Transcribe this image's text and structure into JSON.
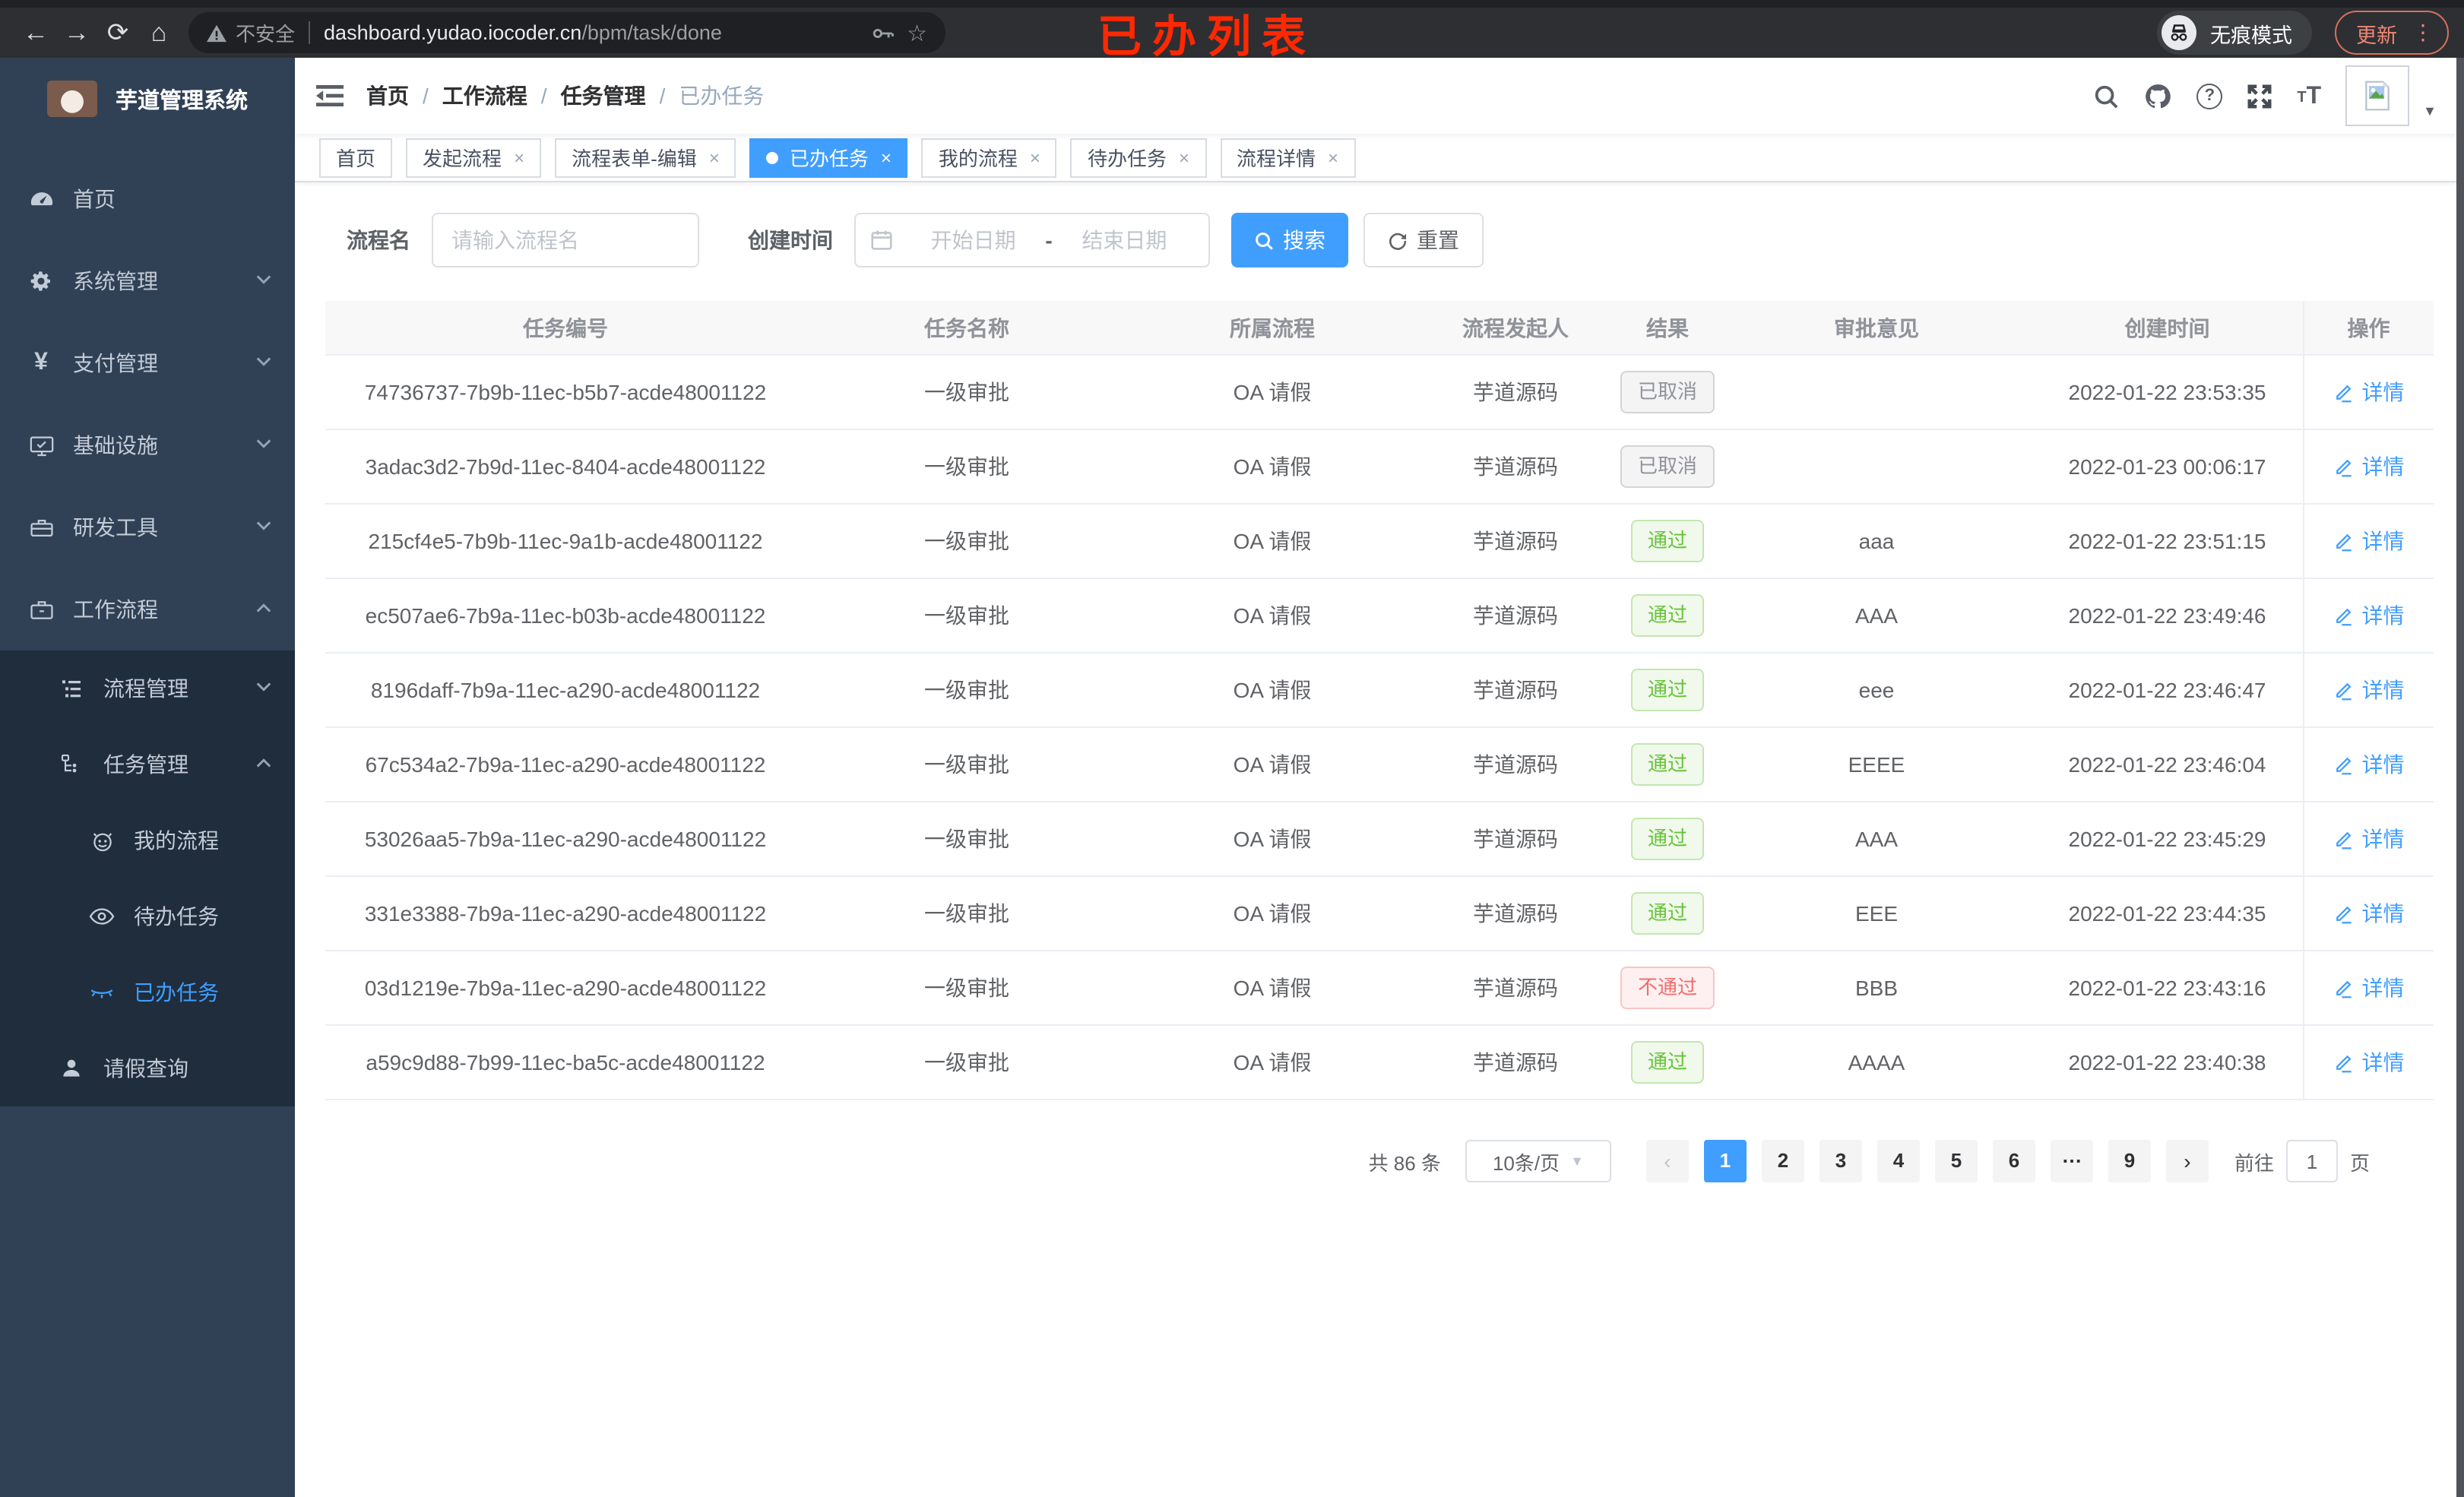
{
  "annotation": {
    "text": "已办列表",
    "color": "#ff2800"
  },
  "browser": {
    "insecure_label": "不安全",
    "url_host": "dashboard.yudao.iocoder.cn",
    "url_path": "/bpm/task/done",
    "incognito_label": "无痕模式",
    "update_label": "更新"
  },
  "colors": {
    "accent": "#409eff",
    "success": "#67c23a",
    "danger": "#f56c6c",
    "info": "#909399"
  },
  "sidebar": {
    "title": "芋道管理系统",
    "items": [
      {
        "label": "首页",
        "icon": "dashboard-icon",
        "level": 1,
        "sub": false,
        "chevron": "",
        "active": false
      },
      {
        "label": "系统管理",
        "icon": "gear-icon",
        "level": 1,
        "sub": false,
        "chevron": "down",
        "active": false
      },
      {
        "label": "支付管理",
        "icon": "yen-icon",
        "level": 1,
        "sub": false,
        "chevron": "down",
        "active": false
      },
      {
        "label": "基础设施",
        "icon": "monitor-icon",
        "level": 1,
        "sub": false,
        "chevron": "down",
        "active": false
      },
      {
        "label": "研发工具",
        "icon": "toolbox-icon",
        "level": 1,
        "sub": false,
        "chevron": "down",
        "active": false
      },
      {
        "label": "工作流程",
        "icon": "briefcase-icon",
        "level": 1,
        "sub": false,
        "chevron": "up",
        "active": false
      },
      {
        "label": "流程管理",
        "icon": "list-icon",
        "level": 2,
        "sub": true,
        "chevron": "down",
        "active": false
      },
      {
        "label": "任务管理",
        "icon": "tree-icon",
        "level": 2,
        "sub": true,
        "chevron": "up",
        "active": false
      },
      {
        "label": "我的流程",
        "icon": "robot-icon",
        "level": 3,
        "sub": true,
        "chevron": "",
        "active": false
      },
      {
        "label": "待办任务",
        "icon": "eye-open-icon",
        "level": 3,
        "sub": true,
        "chevron": "",
        "active": false
      },
      {
        "label": "已办任务",
        "icon": "eye-closed-icon",
        "level": 3,
        "sub": true,
        "chevron": "",
        "active": true
      },
      {
        "label": "请假查询",
        "icon": "user-icon",
        "level": 2,
        "sub": true,
        "chevron": "",
        "active": false
      }
    ]
  },
  "header": {
    "breadcrumb": [
      "首页",
      "工作流程",
      "任务管理",
      "已办任务"
    ]
  },
  "tabs": [
    {
      "label": "首页",
      "closable": false,
      "active": false
    },
    {
      "label": "发起流程",
      "closable": true,
      "active": false
    },
    {
      "label": "流程表单-编辑",
      "closable": true,
      "active": false
    },
    {
      "label": "已办任务",
      "closable": true,
      "active": true
    },
    {
      "label": "我的流程",
      "closable": true,
      "active": false
    },
    {
      "label": "待办任务",
      "closable": true,
      "active": false
    },
    {
      "label": "流程详情",
      "closable": true,
      "active": false
    }
  ],
  "filters": {
    "name_label": "流程名",
    "name_placeholder": "请输入流程名",
    "time_label": "创建时间",
    "start_placeholder": "开始日期",
    "range_separator": "-",
    "end_placeholder": "结束日期",
    "search_label": "搜索",
    "reset_label": "重置"
  },
  "table": {
    "columns": [
      "任务编号",
      "任务名称",
      "所属流程",
      "流程发起人",
      "结果",
      "审批意见",
      "创建时间",
      "操作"
    ],
    "detail_label": "详情",
    "rows": [
      {
        "id": "74736737-7b9b-11ec-b5b7-acde48001122",
        "name": "一级审批",
        "process": "OA 请假",
        "initiator": "芋道源码",
        "result": "已取消",
        "result_type": "info",
        "comment": "",
        "time": "2022-01-22 23:53:35"
      },
      {
        "id": "3adac3d2-7b9d-11ec-8404-acde48001122",
        "name": "一级审批",
        "process": "OA 请假",
        "initiator": "芋道源码",
        "result": "已取消",
        "result_type": "info",
        "comment": "",
        "time": "2022-01-23 00:06:17"
      },
      {
        "id": "215cf4e5-7b9b-11ec-9a1b-acde48001122",
        "name": "一级审批",
        "process": "OA 请假",
        "initiator": "芋道源码",
        "result": "通过",
        "result_type": "success",
        "comment": "aaa",
        "time": "2022-01-22 23:51:15"
      },
      {
        "id": "ec507ae6-7b9a-11ec-b03b-acde48001122",
        "name": "一级审批",
        "process": "OA 请假",
        "initiator": "芋道源码",
        "result": "通过",
        "result_type": "success",
        "comment": "AAA",
        "time": "2022-01-22 23:49:46"
      },
      {
        "id": "8196daff-7b9a-11ec-a290-acde48001122",
        "name": "一级审批",
        "process": "OA 请假",
        "initiator": "芋道源码",
        "result": "通过",
        "result_type": "success",
        "comment": "eee",
        "time": "2022-01-22 23:46:47"
      },
      {
        "id": "67c534a2-7b9a-11ec-a290-acde48001122",
        "name": "一级审批",
        "process": "OA 请假",
        "initiator": "芋道源码",
        "result": "通过",
        "result_type": "success",
        "comment": "EEEE",
        "time": "2022-01-22 23:46:04"
      },
      {
        "id": "53026aa5-7b9a-11ec-a290-acde48001122",
        "name": "一级审批",
        "process": "OA 请假",
        "initiator": "芋道源码",
        "result": "通过",
        "result_type": "success",
        "comment": "AAA",
        "time": "2022-01-22 23:45:29"
      },
      {
        "id": "331e3388-7b9a-11ec-a290-acde48001122",
        "name": "一级审批",
        "process": "OA 请假",
        "initiator": "芋道源码",
        "result": "通过",
        "result_type": "success",
        "comment": "EEE",
        "time": "2022-01-22 23:44:35"
      },
      {
        "id": "03d1219e-7b9a-11ec-a290-acde48001122",
        "name": "一级审批",
        "process": "OA 请假",
        "initiator": "芋道源码",
        "result": "不通过",
        "result_type": "danger",
        "comment": "BBB",
        "time": "2022-01-22 23:43:16"
      },
      {
        "id": "a59c9d88-7b99-11ec-ba5c-acde48001122",
        "name": "一级审批",
        "process": "OA 请假",
        "initiator": "芋道源码",
        "result": "通过",
        "result_type": "success",
        "comment": "AAAA",
        "time": "2022-01-22 23:40:38"
      }
    ]
  },
  "pagination": {
    "total_text": "共 86 条",
    "page_size": "10条/页",
    "pages": [
      {
        "label": "1",
        "active": true
      },
      {
        "label": "2",
        "active": false
      },
      {
        "label": "3",
        "active": false
      },
      {
        "label": "4",
        "active": false
      },
      {
        "label": "5",
        "active": false
      },
      {
        "label": "6",
        "active": false
      },
      {
        "label": "⋯",
        "active": false
      },
      {
        "label": "9",
        "active": false
      }
    ],
    "goto_label": "前往",
    "goto_value": "1",
    "page_unit": "页"
  }
}
